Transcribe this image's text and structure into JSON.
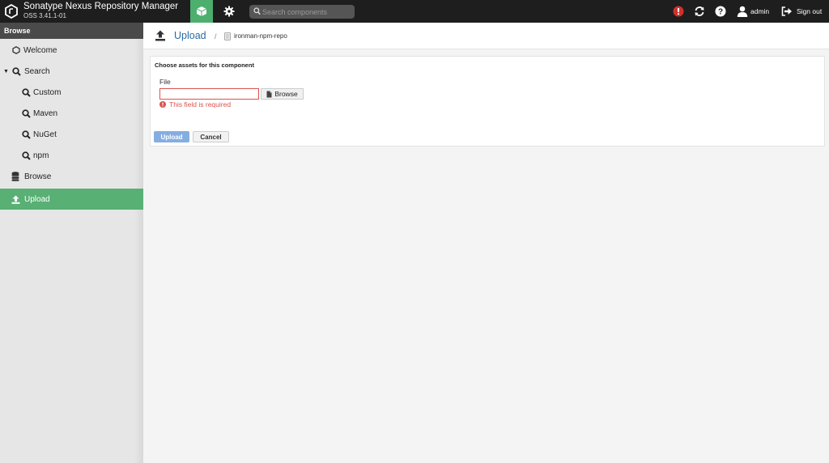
{
  "header": {
    "title": "Sonatype Nexus Repository Manager",
    "version": "OSS 3.41.1-01",
    "search_placeholder": "Search components",
    "user": "admin",
    "signout": "Sign out"
  },
  "sidebar": {
    "header": "Browse",
    "items": [
      {
        "label": "Welcome",
        "icon": "hexagon-icon"
      },
      {
        "label": "Search",
        "icon": "search-icon"
      },
      {
        "label": "Custom",
        "icon": "search-icon"
      },
      {
        "label": "Maven",
        "icon": "search-icon"
      },
      {
        "label": "NuGet",
        "icon": "search-icon"
      },
      {
        "label": "npm",
        "icon": "search-icon"
      },
      {
        "label": "Browse",
        "icon": "database-icon"
      },
      {
        "label": "Upload",
        "icon": "upload-icon"
      }
    ]
  },
  "page": {
    "title": "Upload",
    "separator": "/",
    "repo": "ironman-npm-repo"
  },
  "form": {
    "title": "Choose assets for this component",
    "file_label": "File",
    "browse": "Browse",
    "error": "This field is required",
    "upload": "Upload",
    "cancel": "Cancel"
  },
  "colors": {
    "header_bg": "#1e1e1e",
    "accent_green": "#58b074",
    "link_blue": "#2b6aa6",
    "error_red": "#d9534f"
  }
}
